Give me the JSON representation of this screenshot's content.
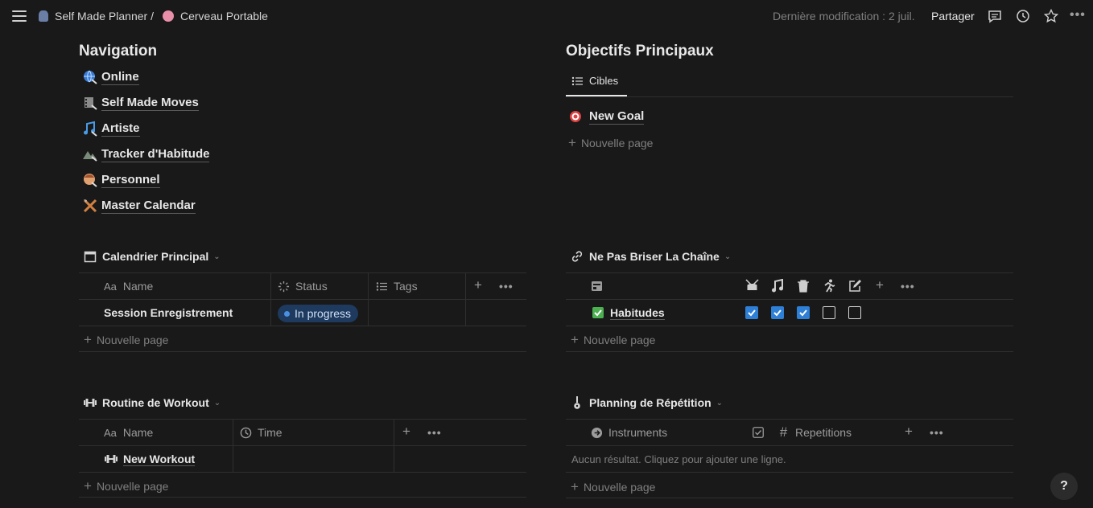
{
  "topbar": {
    "crumb_workspace": "Self Made Planner /",
    "crumb_page": "Cerveau Portable",
    "last_modified": "Dernière modification : 2 juil.",
    "share": "Partager"
  },
  "navigation": {
    "title": "Navigation",
    "links": [
      "Online",
      "Self Made Moves",
      "Artiste",
      "Tracker d'Habitude",
      "Personnel",
      "Master Calendar"
    ]
  },
  "objectifs": {
    "title": "Objectifs Principaux",
    "tab": "Cibles",
    "goal": "New Goal",
    "new_page": "Nouvelle page"
  },
  "calendrier": {
    "title": "Calendrier Principal",
    "col_name": "Name",
    "col_status": "Status",
    "col_tags": "Tags",
    "row_name": "Session Enregistrement",
    "row_status": "In progress",
    "status_color": "#4a90e2",
    "new_page": "Nouvelle page"
  },
  "chaine": {
    "title": "Ne Pas Briser La Chaîne",
    "row_name": "Habitudes",
    "checks": [
      true,
      true,
      true,
      false,
      false
    ],
    "new_page": "Nouvelle page"
  },
  "workout": {
    "title": "Routine de Workout",
    "col_name": "Name",
    "col_time": "Time",
    "row_name": "New Workout",
    "new_page": "Nouvelle page"
  },
  "repetition": {
    "title": "Planning de Répétition",
    "col_instruments": "Instruments",
    "col_repetitions": "Repetitions",
    "empty": "Aucun résultat. Cliquez pour ajouter une ligne.",
    "new_page": "Nouvelle page"
  },
  "help": "?",
  "colors": {
    "background": "#191919",
    "accent": "#2e7fd6"
  }
}
